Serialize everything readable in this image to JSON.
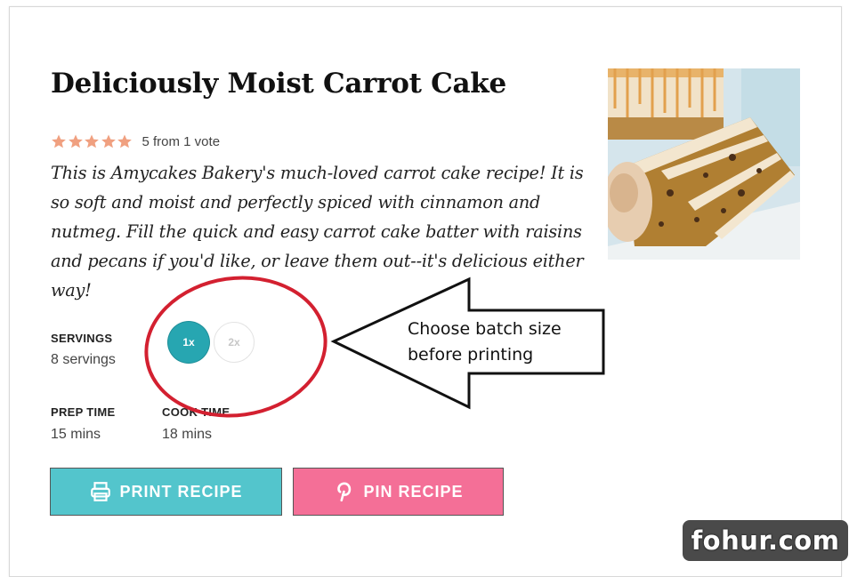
{
  "recipe": {
    "title": "Deliciously Moist Carrot Cake",
    "rating": {
      "stars": 5,
      "text": "5 from 1 vote",
      "star_color": "#f0a080"
    },
    "summary": "This is Amycakes Bakery's much-loved carrot cake recipe! It is so soft and moist and perfectly spiced with cinnamon and nutmeg. Fill the quick and easy carrot cake batter with raisins and pecans if you'd like, or leave them out--it's delicious either way!",
    "image_subject": "slice of carrot cake with cream cheese frosting"
  },
  "servings": {
    "label": "SERVINGS",
    "value": "8 servings"
  },
  "batch": {
    "options": [
      "1x",
      "2x"
    ],
    "selected": "1x",
    "accent": "#27a6b1"
  },
  "times": {
    "prep": {
      "label": "PREP TIME",
      "value": "15 mins"
    },
    "cook": {
      "label": "COOK TIME",
      "value": "18 mins"
    }
  },
  "buttons": {
    "print": {
      "label": "PRINT RECIPE",
      "icon": "printer-icon",
      "color": "#53c5cc"
    },
    "pin": {
      "label": "PIN RECIPE",
      "icon": "pinterest-icon",
      "color": "#f46f97"
    }
  },
  "annotation": {
    "text_line1": "Choose batch size",
    "text_line2": "before printing",
    "circle_color": "#d32030"
  },
  "watermark": {
    "text": "fohur.com"
  }
}
